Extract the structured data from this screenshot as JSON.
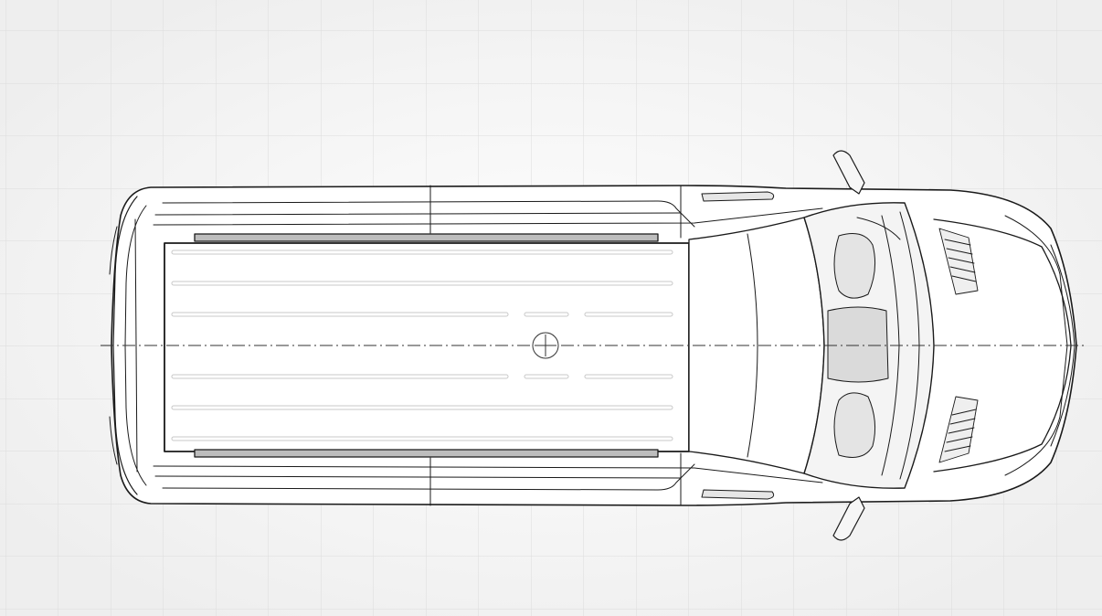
{
  "view": {
    "orientation": "top-down",
    "subject": "van-roof",
    "show_grid": true,
    "show_centerline": true
  },
  "colors": {
    "background": "#f3f3f3",
    "grid": "#dcdcdc",
    "outline": "#1a1a1a",
    "fill": "#ffffff",
    "shade": "#d9d9d9",
    "rail": "#bdbdbd"
  }
}
